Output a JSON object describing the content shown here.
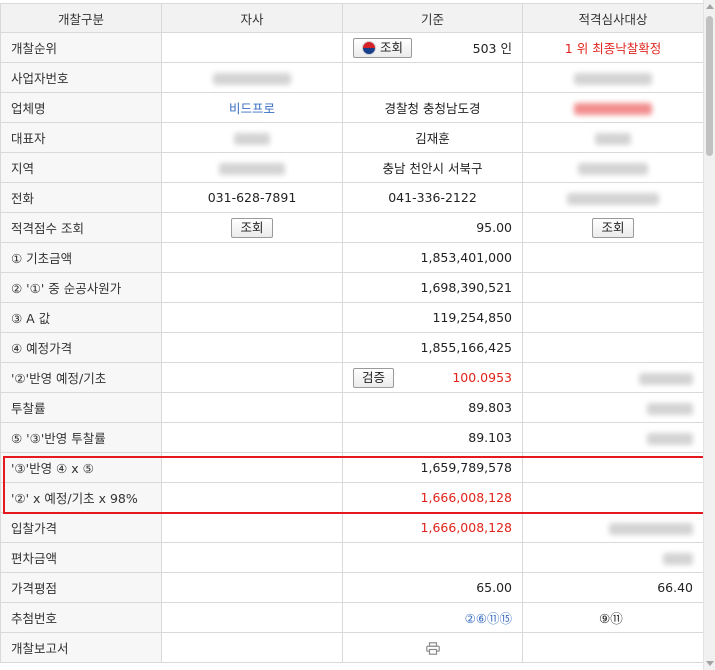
{
  "header": {
    "col_category": "개찰구분",
    "col_self": "자사",
    "col_base": "기준",
    "col_target": "적격심사대상"
  },
  "rows": {
    "rank": {
      "label": "개찰순위",
      "lookup_button": "조회",
      "count": "503 인",
      "target": "1 위 최종낙찰확정"
    },
    "bizno": {
      "label": "사업자번호"
    },
    "company": {
      "label": "업체명",
      "self": "비드프로",
      "base": "경찰청 충청남도경"
    },
    "ceo": {
      "label": "대표자",
      "base": "김재훈"
    },
    "region": {
      "label": "지역",
      "base": "충남 천안시 서북구"
    },
    "phone": {
      "label": "전화",
      "self": "031-628-7891",
      "base": "041-336-2122"
    },
    "score": {
      "label": "적격점수 조회",
      "self_button": "조회",
      "base": "95.00",
      "target_button": "조회"
    },
    "basic_amount": {
      "label": "① 기초금액",
      "base": "1,853,401,000"
    },
    "net_cost": {
      "label": "② '①' 중 순공사원가",
      "base": "1,698,390,521"
    },
    "a_value": {
      "label": "③ A 값",
      "base": "119,254,850"
    },
    "est_price": {
      "label": "④ 예정가격",
      "base": "1,855,166,425"
    },
    "ratio": {
      "label": "'②'반영 예정/기초",
      "verify_button": "검증",
      "base": "100.0953"
    },
    "bid_rate": {
      "label": "투찰률",
      "base": "89.803"
    },
    "adj_rate": {
      "label": "⑤ '③'반영 투찰률",
      "base": "89.103"
    },
    "calc1": {
      "label": "'③'반영 ④ x ⑤",
      "base": "1,659,789,578"
    },
    "calc2": {
      "label": "'②' x 예정/기초 x 98%",
      "base": "1,666,008,128"
    },
    "bid_price": {
      "label": "입찰가격",
      "base": "1,666,008,128"
    },
    "deviation": {
      "label": "편차금액"
    },
    "price_score": {
      "label": "가격평점",
      "base": "65.00",
      "target": "66.40"
    },
    "lottery": {
      "label": "추첨번호",
      "base": "②⑥⑪⑮",
      "target": "⑨⑪"
    },
    "report": {
      "label": "개찰보고서"
    }
  },
  "colors": {
    "accent_red": "#e0241b",
    "link_blue": "#3a6ec2",
    "header_bg": "#f2f2f2",
    "highlight_border": "#e3191e"
  },
  "icons": {
    "flag": "korea-flag-icon",
    "print": "printer-icon"
  }
}
